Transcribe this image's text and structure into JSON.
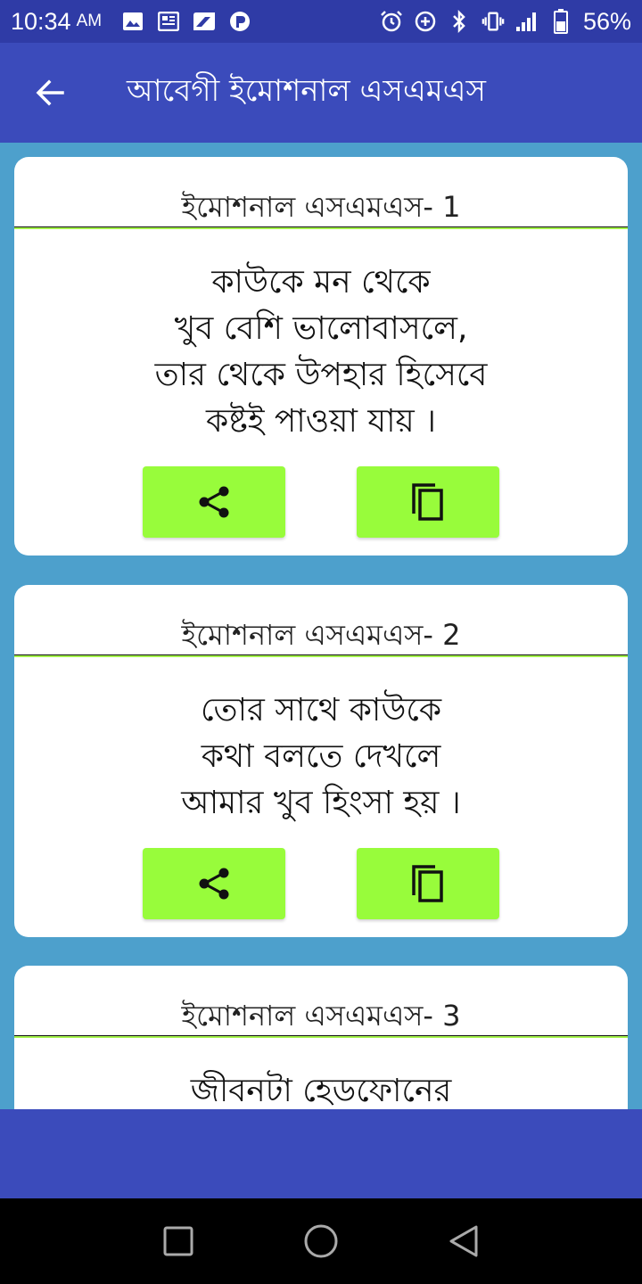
{
  "status_bar": {
    "time": "10:34",
    "ampm": "AM",
    "battery_percent": "56%",
    "left_icons": [
      "image-icon",
      "news-icon",
      "sd-card-icon",
      "p-icon"
    ],
    "right_icons": [
      "alarm-icon",
      "data-saver-icon",
      "bluetooth-icon",
      "vibrate-icon",
      "signal-icon",
      "battery-icon"
    ]
  },
  "app_bar": {
    "title": "আবেগী ইমোশনাল এসএমএস",
    "back_icon": "arrow-left-icon"
  },
  "cards": [
    {
      "title": "ইমোশনাল এসএমএস- 1",
      "lines": [
        "কাউকে মন থেকে",
        "খুব বেশি ভালোবাসলে,",
        "তার থেকে উপহার হিসেবে",
        "কষ্টই পাওয়া যায় ।"
      ]
    },
    {
      "title": "ইমোশনাল এসএমএস- 2",
      "lines": [
        "তোর সাথে কাউকে",
        "কথা বলতে দেখলে",
        "আমার খুব হিংসা হয় ।"
      ]
    },
    {
      "title": "ইমোশনাল এসএমএস- 3",
      "lines": [
        "জীবনটা হেডফোনের"
      ]
    }
  ],
  "actions": {
    "share_icon": "share-icon",
    "copy_icon": "copy-icon"
  },
  "colors": {
    "status_bar": "#2f3ba6",
    "app_bar": "#3b4bbb",
    "background": "#4da0cc",
    "action_button": "#98fc3b",
    "divider_accent": "#a4f24a"
  },
  "nav_bar": {
    "icons": [
      "recents-icon",
      "home-icon",
      "back-icon"
    ]
  }
}
